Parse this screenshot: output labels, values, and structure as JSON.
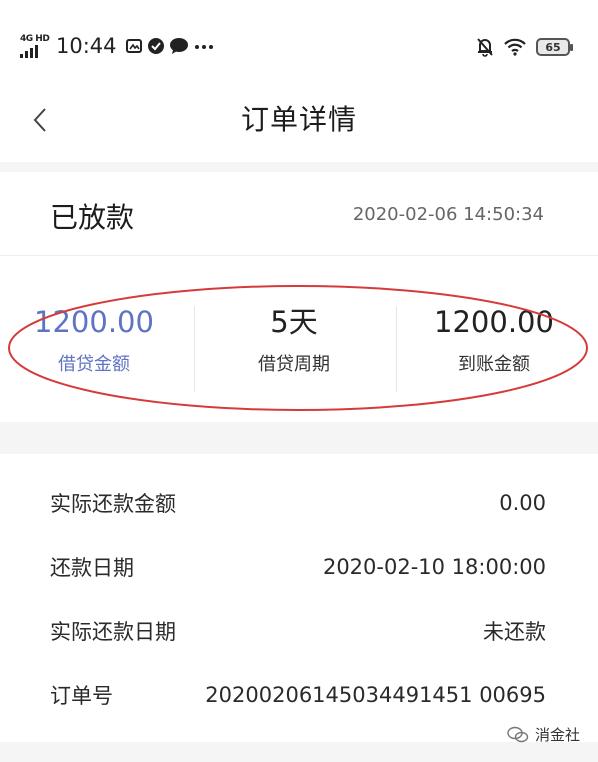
{
  "status_bar": {
    "network": "4G HD",
    "time": "10:44",
    "battery": "65",
    "icons": [
      "signal-icon",
      "screenshot-icon",
      "check-badge-icon",
      "chat-icon",
      "more-dots-icon",
      "mute-bell-icon",
      "wifi-icon",
      "battery-icon"
    ]
  },
  "header": {
    "title": "订单详情",
    "back_icon": "chevron-left-icon"
  },
  "order": {
    "status": "已放款",
    "datetime": "2020-02-06 14:50:34"
  },
  "stats": [
    {
      "value": "1200.00",
      "label": "借贷金额"
    },
    {
      "value": "5天",
      "label": "借贷周期"
    },
    {
      "value": "1200.00",
      "label": "到账金额"
    }
  ],
  "details": [
    {
      "label": "实际还款金额",
      "value": "0.00"
    },
    {
      "label": "还款日期",
      "value": "2020-02-10 18:00:00"
    },
    {
      "label": "实际还款日期",
      "value": "未还款"
    },
    {
      "label": "订单号",
      "value": "20200206145034491451 00695"
    }
  ],
  "watermark": {
    "text": "消金社",
    "icon": "wechat-icon"
  },
  "colors": {
    "accent": "#5f73c4",
    "annotation": "#d63b3b",
    "background": "#f5f5f5",
    "card": "#ffffff"
  }
}
